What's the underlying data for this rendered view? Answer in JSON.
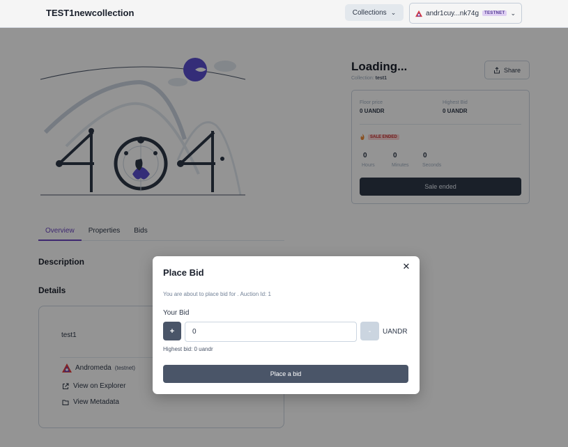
{
  "header": {
    "brand": "TEST1newcollection",
    "collections_label": "Collections",
    "wallet_address": "andr1cuy...nk74g",
    "wallet_network_badge": "TESTNET"
  },
  "nft": {
    "title": "Loading...",
    "collection_label": "Collection:",
    "collection_value": "test1",
    "share_label": "Share",
    "floor_price_label": "Floor price",
    "floor_price_value": "0 UANDR",
    "highest_bid_label": "Highest Bid",
    "highest_bid_value": "0 UANDR",
    "sale_status": "SALE ENDED",
    "countdown": [
      {
        "value": "0",
        "label": "Hours"
      },
      {
        "value": "0",
        "label": "Minutes"
      },
      {
        "value": "0",
        "label": "Seconds"
      }
    ],
    "sale_button": "Sale ended"
  },
  "tabs": [
    "Overview",
    "Properties",
    "Bids"
  ],
  "sections": {
    "description": "Description",
    "details": "Details"
  },
  "details": {
    "name": "test1",
    "chain_name": "Andromeda",
    "chain_network": "(testnet)",
    "explorer_link": "View on Explorer",
    "metadata_link": "View Metadata"
  },
  "modal": {
    "title": "Place Bid",
    "description": "You are about to place bid for . Auction Id: 1",
    "bid_label": "Your Bid",
    "plus_label": "+",
    "bid_value": "0",
    "minus_label": "-",
    "unit": "UANDR",
    "highest_bid_text": "Highest bid: 0 uandr",
    "submit_label": "Place a bid"
  },
  "colors": {
    "accent": "#6b46c1",
    "primary_button": "#4a5568",
    "sale_ended_badge": "#fed7d7"
  }
}
